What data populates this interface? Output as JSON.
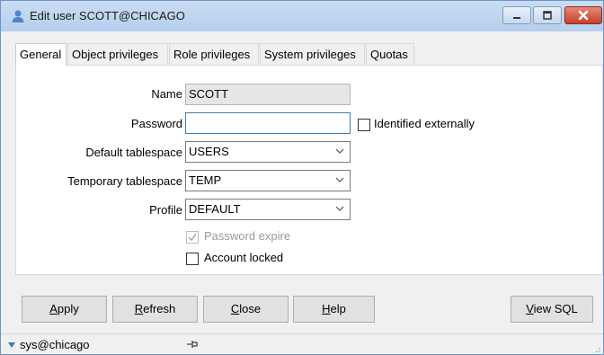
{
  "window": {
    "title": "Edit user SCOTT@CHICAGO"
  },
  "tabs": [
    {
      "label": "General",
      "active": true
    },
    {
      "label": "Object privileges"
    },
    {
      "label": "Role privileges"
    },
    {
      "label": "System privileges"
    },
    {
      "label": "Quotas"
    }
  ],
  "form": {
    "name": {
      "label": "Name",
      "value": "SCOTT"
    },
    "password": {
      "label": "Password",
      "value": ""
    },
    "identified_externally": {
      "label": "Identified externally",
      "checked": false
    },
    "default_tablespace": {
      "label": "Default tablespace",
      "value": "USERS"
    },
    "temporary_tablespace": {
      "label": "Temporary tablespace",
      "value": "TEMP"
    },
    "profile": {
      "label": "Profile",
      "value": "DEFAULT"
    },
    "password_expire": {
      "label": "Password expire",
      "checked": true,
      "disabled": true
    },
    "account_locked": {
      "label": "Account locked",
      "checked": false
    }
  },
  "buttons": {
    "apply": {
      "mnemonic": "A",
      "rest": "pply"
    },
    "refresh": {
      "mnemonic": "R",
      "rest": "efresh"
    },
    "close": {
      "mnemonic": "C",
      "rest": "lose"
    },
    "help": {
      "mnemonic": "H",
      "rest": "elp"
    },
    "view_sql": {
      "mnemonic": "V",
      "rest": "iew SQL"
    }
  },
  "status": {
    "connection": "sys@chicago"
  },
  "colors": {
    "titlebar": "#c4d8f0",
    "close_button": "#c7402b",
    "focus_border": "#3c7fb1"
  }
}
